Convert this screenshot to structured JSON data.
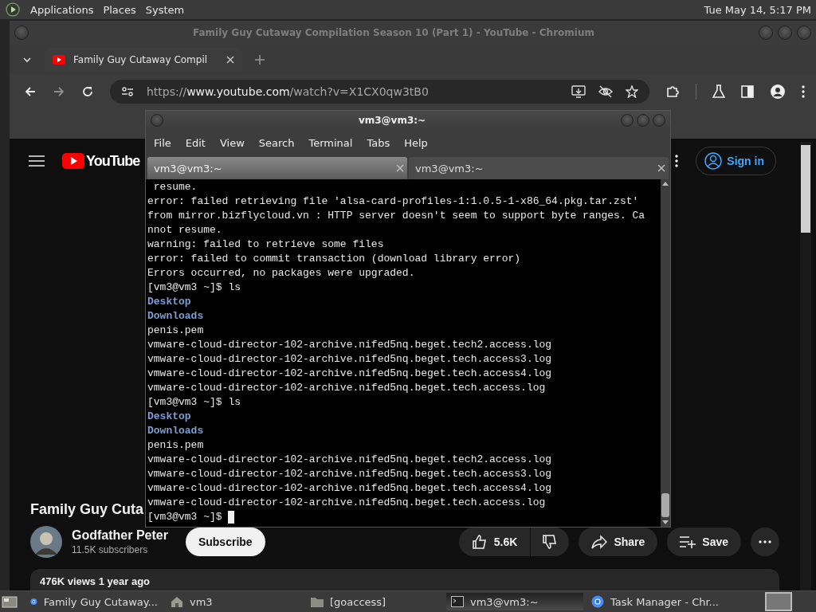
{
  "top_panel": {
    "menus": [
      "Applications",
      "Places",
      "System"
    ],
    "clock": "Tue May 14,  5:17 PM"
  },
  "browser": {
    "window_title": "Family Guy Cutaway Compilation Season 10 (Part 1) - YouTube - Chromium",
    "tabs": [
      {
        "title": "Family Guy Cutaway Compil",
        "selected": true
      }
    ],
    "forward_disabled": true,
    "url": {
      "scheme": "https://",
      "host": "www.youtube.com",
      "path": "/watch?v=X1CX0qw3tB0"
    }
  },
  "youtube": {
    "logo_text": "YouTube",
    "sign_in": "Sign in",
    "video_title": "Family Guy Cuta",
    "channel": "Godfather Peter",
    "subscribers": "11.5K subscribers",
    "subscribe": "Subscribe",
    "likes": "5.6K",
    "share": "Share",
    "save": "Save",
    "description": "476K views  1 year ago"
  },
  "terminal": {
    "title": "vm3@vm3:~",
    "menus": [
      "File",
      "Edit",
      "View",
      "Search",
      "Terminal",
      "Tabs",
      "Help"
    ],
    "tabs": [
      {
        "label": "vm3@vm3:~",
        "selected": true
      },
      {
        "label": "vm3@vm3:~",
        "selected": false
      }
    ],
    "lines": [
      {
        "kind": "out",
        "text": " resume."
      },
      {
        "kind": "out",
        "text": "error: failed retrieving file 'alsa-card-profiles-1:1.0.5-1-x86_64.pkg.tar.zst'"
      },
      {
        "kind": "out",
        "text": "from mirror.bizflycloud.vn : HTTP server doesn't seem to support byte ranges. Ca"
      },
      {
        "kind": "out",
        "text": "nnot resume."
      },
      {
        "kind": "out",
        "text": "warning: failed to retrieve some files"
      },
      {
        "kind": "out",
        "text": "error: failed to commit transaction (download library error)"
      },
      {
        "kind": "out",
        "text": "Errors occurred, no packages were upgraded."
      },
      {
        "kind": "out",
        "text": "[vm3@vm3 ~]$ ls"
      },
      {
        "kind": "dir",
        "text": "Desktop"
      },
      {
        "kind": "dir",
        "text": "Downloads"
      },
      {
        "kind": "out",
        "text": "penis.pem"
      },
      {
        "kind": "out",
        "text": "vmware-cloud-director-102-archive.nifed5nq.beget.tech2.access.log"
      },
      {
        "kind": "out",
        "text": "vmware-cloud-director-102-archive.nifed5nq.beget.tech.access3.log"
      },
      {
        "kind": "out",
        "text": "vmware-cloud-director-102-archive.nifed5nq.beget.tech.access4.log"
      },
      {
        "kind": "out",
        "text": "vmware-cloud-director-102-archive.nifed5nq.beget.tech.access.log"
      },
      {
        "kind": "out",
        "text": "[vm3@vm3 ~]$ ls"
      },
      {
        "kind": "dir",
        "text": "Desktop"
      },
      {
        "kind": "dir",
        "text": "Downloads"
      },
      {
        "kind": "out",
        "text": "penis.pem"
      },
      {
        "kind": "out",
        "text": "vmware-cloud-director-102-archive.nifed5nq.beget.tech2.access.log"
      },
      {
        "kind": "out",
        "text": "vmware-cloud-director-102-archive.nifed5nq.beget.tech.access3.log"
      },
      {
        "kind": "out",
        "text": "vmware-cloud-director-102-archive.nifed5nq.beget.tech.access4.log"
      },
      {
        "kind": "out",
        "text": "vmware-cloud-director-102-archive.nifed5nq.beget.tech.access.log"
      },
      {
        "kind": "out",
        "text": "[vm3@vm3 ~]$ "
      }
    ],
    "cursor": true
  },
  "taskbar": {
    "items": [
      {
        "label": "Family Guy Cutaway...",
        "kind": "browser",
        "selected": false
      },
      {
        "label": "vm3",
        "kind": "home",
        "selected": false
      },
      {
        "label": "[goaccess]",
        "kind": "folder",
        "selected": false
      },
      {
        "label": "vm3@vm3:~",
        "kind": "terminal",
        "selected": true
      },
      {
        "label": "Task Manager - Chr...",
        "kind": "browser",
        "selected": false
      }
    ]
  }
}
